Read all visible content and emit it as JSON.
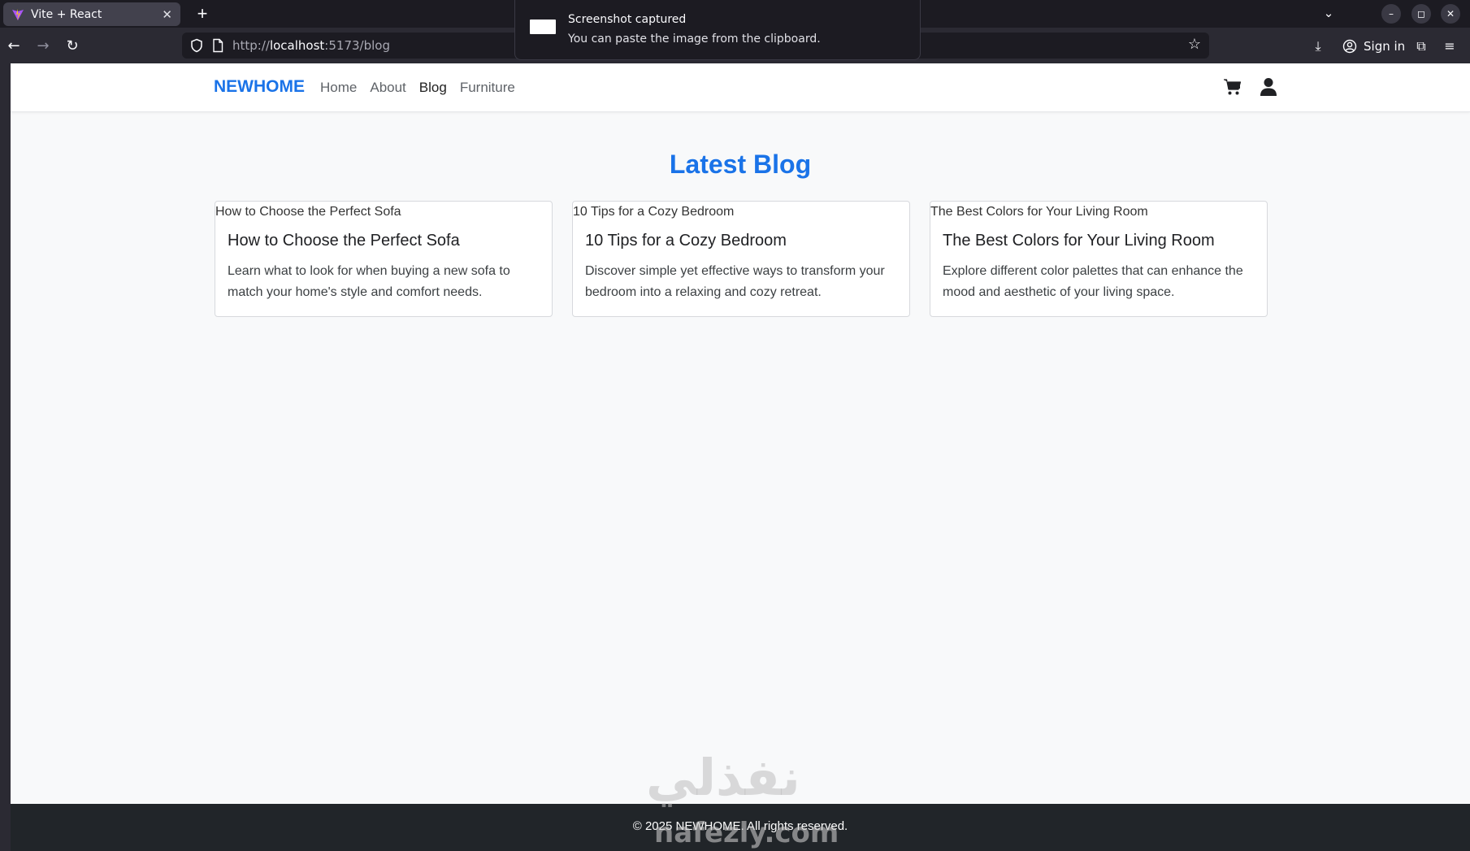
{
  "browser": {
    "tab": {
      "title": "Vite + React",
      "close_icon": "close-icon"
    },
    "new_tab_label": "+",
    "url": {
      "prefix": "http://",
      "host": "localhost",
      "path": ":5173/blog"
    },
    "sign_in_label": "Sign in",
    "window_controls": {
      "minimize": "–",
      "restore": "◻",
      "close": "✕"
    }
  },
  "toast": {
    "title": "Screenshot captured",
    "body": "You can paste the image from the clipboard."
  },
  "site": {
    "brand": "NEWHOME",
    "nav": [
      {
        "label": "Home",
        "active": false
      },
      {
        "label": "About",
        "active": false
      },
      {
        "label": "Blog",
        "active": true
      },
      {
        "label": "Furniture",
        "active": false
      }
    ],
    "accent_color": "#1a73e8"
  },
  "blog": {
    "heading": "Latest Blog",
    "posts": [
      {
        "image_alt": "How to Choose the Perfect Sofa",
        "title": "How to Choose the Perfect Sofa",
        "description": "Learn what to look for when buying a new sofa to match your home's style and comfort needs."
      },
      {
        "image_alt": "10 Tips for a Cozy Bedroom",
        "title": "10 Tips for a Cozy Bedroom",
        "description": "Discover simple yet effective ways to transform your bedroom into a relaxing and cozy retreat."
      },
      {
        "image_alt": "The Best Colors for Your Living Room",
        "title": "The Best Colors for Your Living Room",
        "description": "Explore different color palettes that can enhance the mood and aesthetic of your living space."
      }
    ]
  },
  "footer": {
    "text": "© 2025 NEWHOME. All rights reserved."
  },
  "watermark": {
    "arabic": "نفذلي",
    "latin": "nafezly.com"
  }
}
